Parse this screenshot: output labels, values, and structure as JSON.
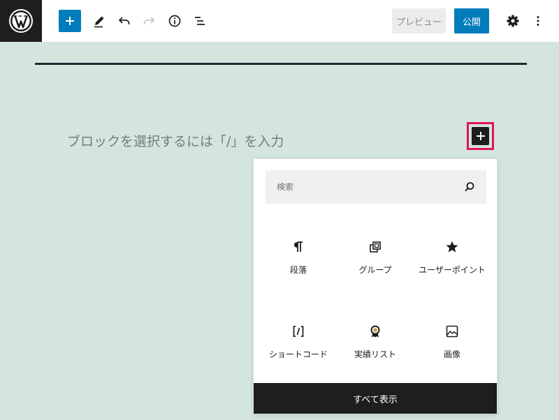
{
  "toolbar": {
    "preview_label": "プレビュー",
    "publish_label": "公開"
  },
  "editor": {
    "placeholder": "ブロックを選択するには「/」を入力"
  },
  "inserter": {
    "search_placeholder": "検索",
    "blocks": [
      {
        "label": "段落",
        "icon": "paragraph-icon"
      },
      {
        "label": "グループ",
        "icon": "group-icon"
      },
      {
        "label": "ユーザーポイント",
        "icon": "star-icon"
      },
      {
        "label": "ショートコード",
        "icon": "shortcode-icon"
      },
      {
        "label": "実績リスト",
        "icon": "award-icon"
      },
      {
        "label": "画像",
        "icon": "image-icon"
      }
    ],
    "show_all_label": "すべて表示"
  }
}
